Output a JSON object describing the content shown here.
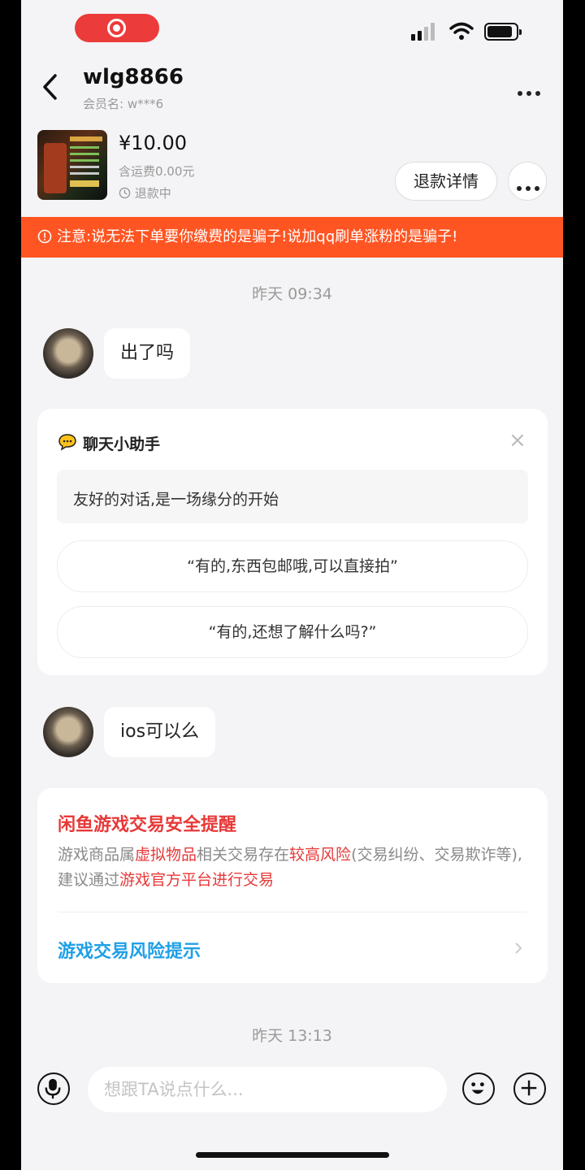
{
  "header": {
    "title": "wlg8866",
    "member_label": "会员名: w***6"
  },
  "product": {
    "price": "¥10.00",
    "shipping": "含运费0.00元",
    "status": "退款中",
    "refund_button": "退款详情"
  },
  "warning": {
    "text": "注意:说无法下单要你缴费的是骗子!说加qq刷单涨粉的是骗子!"
  },
  "chat": {
    "time_1": "昨天 09:34",
    "message_1": "出了吗",
    "assistant": {
      "title": "聊天小助手",
      "greeting": "友好的对话,是一场缘分的开始",
      "suggestions": [
        "“有的,东西包邮哦,可以直接拍”",
        "“有的,还想了解什么吗?”"
      ]
    },
    "message_2": "ios可以么",
    "safety": {
      "title": "闲鱼游戏交易安全提醒",
      "body_1": "游戏商品属",
      "body_hl_1": "虚拟物品",
      "body_2": "相关交易存在",
      "body_hl_2": "较高风险",
      "body_3": "(交易纠纷、交易欺诈等),建议通过",
      "body_hl_3": "游戏官方平台进行交易",
      "link": "游戏交易风险提示"
    },
    "time_2": "昨天 13:13"
  },
  "input_bar": {
    "placeholder": "想跟TA说点什么..."
  },
  "colors": {
    "warning_bg": "#ff5522",
    "record_pill": "#ec3b3b",
    "danger_text": "#e83838",
    "link_text": "#1fa0e6"
  }
}
